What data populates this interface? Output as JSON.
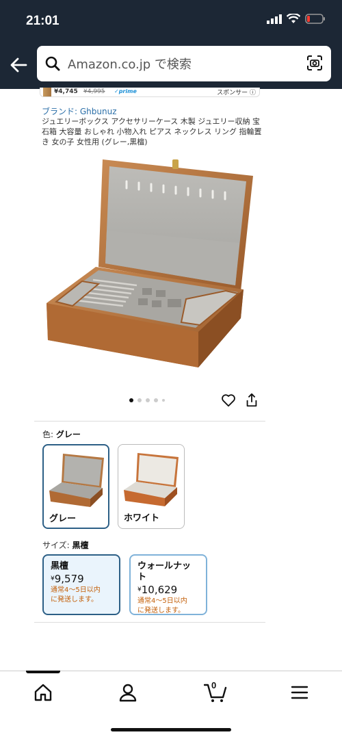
{
  "status_bar": {
    "time": "21:01"
  },
  "search": {
    "placeholder": "Amazon.co.jp で検索"
  },
  "sponsored": {
    "price": "¥4,745",
    "old_price": "¥4,995",
    "prime": "✓prime",
    "label": "スポンサー"
  },
  "product": {
    "brand": "ブランド: Ghbunuz",
    "title": "ジュエリーボックス アクセサリーケース 木製 ジュエリー収納 宝石箱 大容量 おしゃれ 小物入れ ピアス ネックレス リング 指輪置き 女の子 女性用 (グレー,黒檀)"
  },
  "gallery": {
    "image_count": 5,
    "active_index": 0
  },
  "color": {
    "label": "色:",
    "selected": "グレー",
    "options": [
      {
        "name": "グレー",
        "selected": true
      },
      {
        "name": "ホワイト",
        "selected": false
      }
    ]
  },
  "size": {
    "label": "サイズ:",
    "selected": "黒檀",
    "options": [
      {
        "name": "黒檀",
        "yen": "¥",
        "price": "9,579",
        "ship_line1": "通常4～5日以内",
        "ship_line2": "に発送します。",
        "selected": true
      },
      {
        "name": "ウォールナット",
        "yen": "¥",
        "price": "10,629",
        "ship_line1": "通常4～5日以内",
        "ship_line2": "に発送します。",
        "selected": false
      }
    ]
  },
  "bottom_nav": {
    "cart_count": "0",
    "items": [
      "home-icon",
      "account-icon",
      "cart-icon",
      "menu-icon"
    ]
  },
  "colors": {
    "header_bg": "#1c2735",
    "link": "#2b6fa8",
    "selected_border": "#2c5f86",
    "ship_text": "#c4600a"
  }
}
